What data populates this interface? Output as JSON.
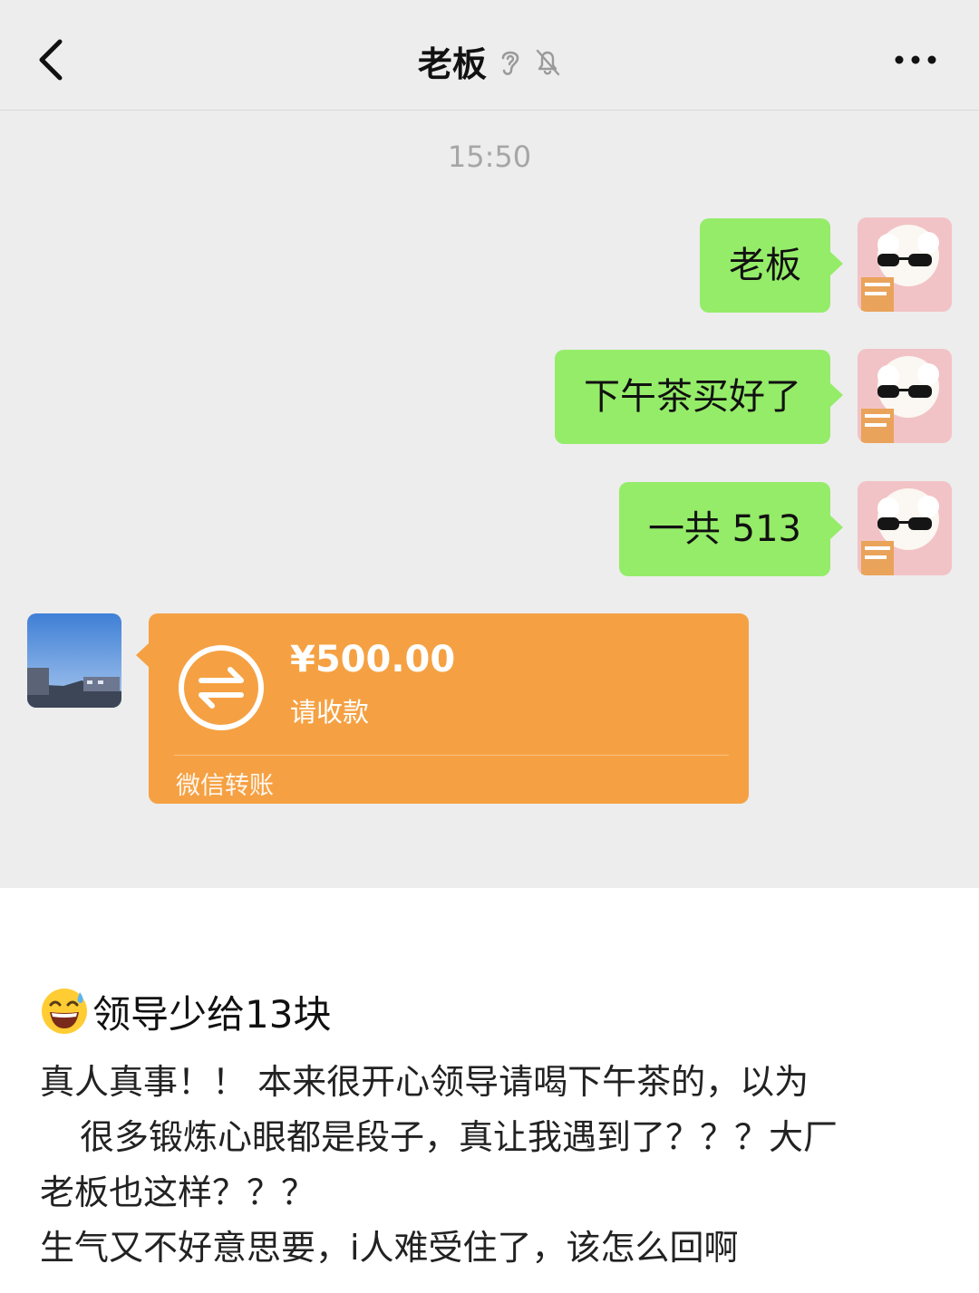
{
  "nav": {
    "title": "老板",
    "back_icon": "chevron-left-icon",
    "ear_icon": "ear-icon",
    "mute_icon": "bell-off-icon",
    "more_icon": "ellipsis-icon"
  },
  "chat": {
    "timestamp": "15:50",
    "messages": [
      {
        "side": "out",
        "text": "老板"
      },
      {
        "side": "out",
        "text": "下午茶买好了"
      },
      {
        "side": "out",
        "text": "一共 513"
      }
    ],
    "transfer": {
      "amount": "¥500.00",
      "status": "请收款",
      "source": "微信转账",
      "icon": "transfer-arrows-icon",
      "color": "#f5a143"
    },
    "bubble_color": "#95ec69"
  },
  "post": {
    "emoji": "grinning-sweat-emoji",
    "title": "领导少给13块",
    "body_lines": [
      "真人真事！！ 本来很开心领导请喝下午茶的，以为",
      "很多锻炼心眼都是段子，真让我遇到了？？？大厂",
      "老板也这样？？？",
      "生气又不好意思要，i人难受住了，该怎么回啊"
    ]
  }
}
